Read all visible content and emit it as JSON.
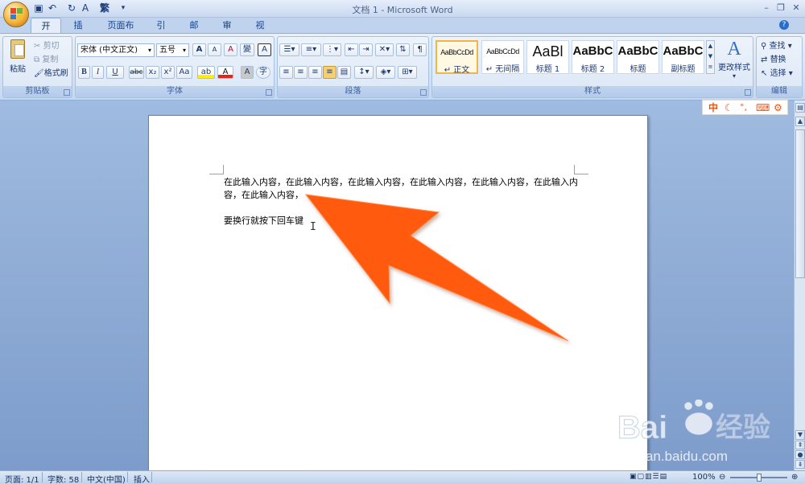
{
  "app": {
    "title": "文档 1 - Microsoft Word"
  },
  "qat": {
    "save_icon": "save-icon",
    "undo_icon": "undo-icon",
    "redo_icon": "redo-icon",
    "spell_icon": "spellcheck-icon",
    "trad_label": "繁"
  },
  "tabs": [
    {
      "label": "开始",
      "active": true
    },
    {
      "label": "插入"
    },
    {
      "label": "页面布局"
    },
    {
      "label": "引用"
    },
    {
      "label": "邮件"
    },
    {
      "label": "审阅"
    },
    {
      "label": "视图"
    }
  ],
  "clipboard": {
    "title": "剪贴板",
    "paste": "粘贴",
    "cut": "剪切",
    "copy": "复制",
    "format_painter": "格式刷"
  },
  "font": {
    "title": "字体",
    "family": "宋体 (中文正文)",
    "size": "五号",
    "grow": "A",
    "shrink": "A",
    "clear": "A",
    "phonetic": "變",
    "border": "A",
    "bold": "B",
    "italic": "I",
    "underline": "U",
    "strike": "abc",
    "sub": "x₂",
    "sup": "x²",
    "case": "Aa",
    "highlight": "ab",
    "color": "A",
    "shade": "A",
    "circle": "字"
  },
  "paragraph": {
    "title": "段落"
  },
  "styles": {
    "title": "样式",
    "items": [
      {
        "sample": "AaBbCcDd",
        "name": "正文",
        "selected": true
      },
      {
        "sample": "AaBbCcDd",
        "name": "无间隔"
      },
      {
        "sample": "AaBl",
        "name": "标题 1"
      },
      {
        "sample": "AaBbC",
        "name": "标题 2"
      },
      {
        "sample": "AaBbC",
        "name": "标题"
      },
      {
        "sample": "AaBbC",
        "name": "副标题"
      }
    ],
    "change": "更改样式"
  },
  "editing": {
    "title": "编辑",
    "find": "查找",
    "replace": "替换",
    "select": "选择"
  },
  "document": {
    "line1": "在此输入内容，在此输入内容，在此输入内容，在此输入内容，在此输入内容，在此输入内",
    "line2": "容，在此输入内容，",
    "line3": "要换行就按下回车键"
  },
  "ime": {
    "mode": "中"
  },
  "status": {
    "page": "页面: 1/1",
    "words": "字数: 58",
    "lang": "中文(中国)",
    "mode": "插入",
    "zoom": "100%"
  },
  "watermark": {
    "brand": "Bai 经验",
    "url": "jingyan.baidu.com"
  },
  "colors": {
    "arrow": "#ff5a10",
    "accent": "#15428b"
  }
}
